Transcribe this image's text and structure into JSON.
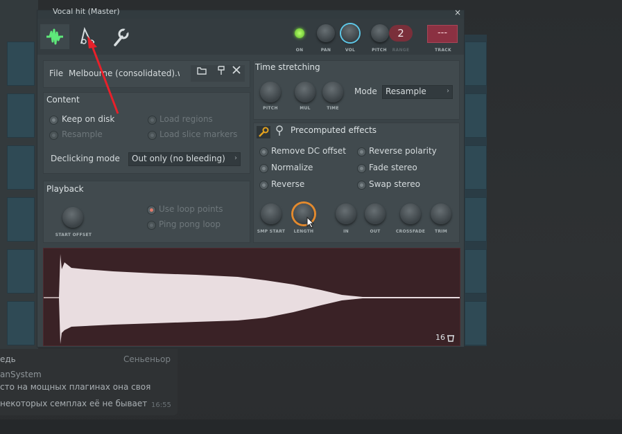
{
  "window": {
    "title": "Vocal hit (Master)",
    "close_glyph": "×"
  },
  "toolbar": {
    "knobs": [
      {
        "key": "on",
        "label": "ON"
      },
      {
        "key": "pan",
        "label": "PAN"
      },
      {
        "key": "vol",
        "label": "VOL"
      },
      {
        "key": "pitch",
        "label": "PITCH"
      },
      {
        "key": "range",
        "label": "RANGE",
        "value": "2"
      }
    ],
    "track_value": "---",
    "track_label": "TRACK"
  },
  "file": {
    "label": "File",
    "name": "Melbourne (consolidated).wav"
  },
  "content": {
    "title": "Content",
    "options": [
      {
        "label": "Keep on disk",
        "enabled": true
      },
      {
        "label": "Resample",
        "enabled": false
      },
      {
        "label": "Load regions",
        "enabled": false
      },
      {
        "label": "Load slice markers",
        "enabled": false
      }
    ],
    "declicking_label": "Declicking mode",
    "declicking_value": "Out only (no bleeding)"
  },
  "playback": {
    "title": "Playback",
    "start_offset_label": "START OFFSET",
    "options": [
      {
        "label": "Use loop points"
      },
      {
        "label": "Ping pong loop"
      }
    ]
  },
  "time_stretching": {
    "title": "Time stretching",
    "knobs": [
      "PITCH",
      "MUL",
      "TIME"
    ],
    "mode_label": "Mode",
    "mode_value": "Resample"
  },
  "precomputed": {
    "title": "Precomputed effects",
    "effects_left": [
      "Remove DC offset",
      "Normalize",
      "Reverse"
    ],
    "effects_right": [
      "Reverse polarity",
      "Fade stereo",
      "Swap stereo"
    ],
    "knobs": [
      "SMP START",
      "LENGTH",
      "IN",
      "OUT",
      "CROSSFADE",
      "TRIM"
    ]
  },
  "waveform": {
    "bits": "16"
  },
  "chat": {
    "line1": "едь",
    "line1_right": "Сеньеньор",
    "line2": "anSystem",
    "line3": "сто на мощных плагинах она своя",
    "line4": "некоторых семплах её не бывает",
    "time": "16:55"
  },
  "colors": {
    "accent_green": "#5ee87a",
    "knob_highlight": "#e38a2e",
    "vol_ring": "#5ec8e8",
    "led": "#7dde3c",
    "annotation_arrow": "#e8202a"
  }
}
